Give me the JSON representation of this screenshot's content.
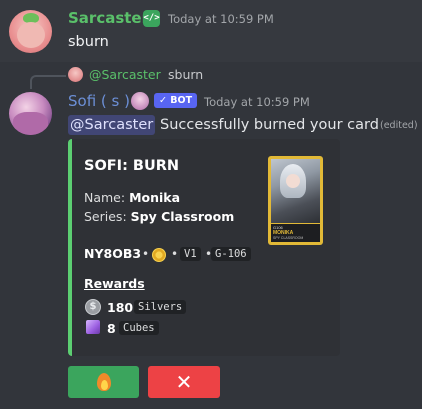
{
  "message1": {
    "author": "Sarcaster",
    "timestamp": "Today at 10:59 PM",
    "content": "sburn",
    "badge_icon": "code-icon"
  },
  "message2": {
    "reply": {
      "author": "@Sarcaster",
      "content": "sburn"
    },
    "author": "Sofi ( s )",
    "bot_badge": "✓ BOT",
    "timestamp": "Today at 10:59 PM",
    "mention": "@Sarcaster",
    "content": "Successfully burned your card",
    "edited": "(edited)",
    "embed": {
      "accent_color": "#5ccf72",
      "title": "SOFI: BURN",
      "name_label": "Name:",
      "name_value": "Monika",
      "series_label": "Series:",
      "series_value": "Spy Classroom",
      "card_code": "NY8OB3",
      "version": "V1",
      "gen": "G-106",
      "card_art": {
        "number": "G106",
        "name": "MONIKA",
        "series": "SPY CLASSROOM"
      },
      "rewards_title": "Rewards",
      "rewards": [
        {
          "icon": "silver-coin-icon",
          "amount": "180",
          "unit": "Silvers"
        },
        {
          "icon": "cube-icon",
          "amount": "8",
          "unit": "Cubes"
        }
      ]
    },
    "buttons": [
      {
        "icon": "fire-icon",
        "color": "#3ba55d"
      },
      {
        "icon": "close-icon",
        "label": "✕",
        "color": "#ed4245"
      }
    ]
  }
}
